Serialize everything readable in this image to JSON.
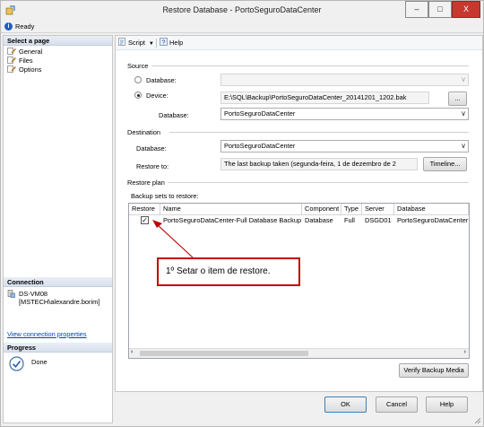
{
  "window": {
    "title": "Restore Database - PortoSeguroDataCenter",
    "controls": {
      "minimize": "–",
      "maximize": "□",
      "close": "X"
    }
  },
  "status": {
    "text": "Ready",
    "icon": "info-icon"
  },
  "left_panel": {
    "select_page_title": "Select a page",
    "pages": [
      {
        "label": "General",
        "icon": "page-wrench-icon"
      },
      {
        "label": "Files",
        "icon": "page-wrench-icon"
      },
      {
        "label": "Options",
        "icon": "page-wrench-icon"
      }
    ],
    "connection_title": "Connection",
    "server": "DS-VM08",
    "user": "[MSTECH\\alexandre.borim]",
    "view_connection_link": "View connection properties",
    "progress_title": "Progress",
    "progress_status": "Done"
  },
  "toolbar": {
    "script_label": "Script",
    "help_label": "Help"
  },
  "source": {
    "section_label": "Source",
    "database_option_label": "Database:",
    "device_option_label": "Device:",
    "selected_option": "device",
    "device_path": "E:\\SQL\\Backup\\PortoSeguroDataCenter_20141201_1202.bak",
    "browse_label": "...",
    "database_label": "Database:",
    "database_value": "PortoSeguroDataCenter"
  },
  "destination": {
    "section_label": "Destination",
    "database_label": "Database:",
    "database_value": "PortoSeguroDataCenter",
    "restore_to_label": "Restore to:",
    "restore_to_value": "The last backup taken (segunda-feira, 1 de dezembro de 2",
    "timeline_label": "Timeline..."
  },
  "restore_plan": {
    "section_label": "Restore plan",
    "backup_sets_label": "Backup sets to restore:",
    "columns": [
      "Restore",
      "Name",
      "Component",
      "Type",
      "Server",
      "Database"
    ],
    "rows": [
      {
        "restore": true,
        "name": "PortoSeguroDataCenter-Full Database Backup",
        "component": "Database",
        "type": "Full",
        "server": "DSGD01",
        "database": "PortoSeguroDataCenter"
      }
    ],
    "verify_label": "Verify Backup Media"
  },
  "annotation": {
    "text": "1º Setar o item de restore.",
    "color": "#c00000"
  },
  "buttons": {
    "ok": "OK",
    "cancel": "Cancel",
    "help": "Help"
  }
}
